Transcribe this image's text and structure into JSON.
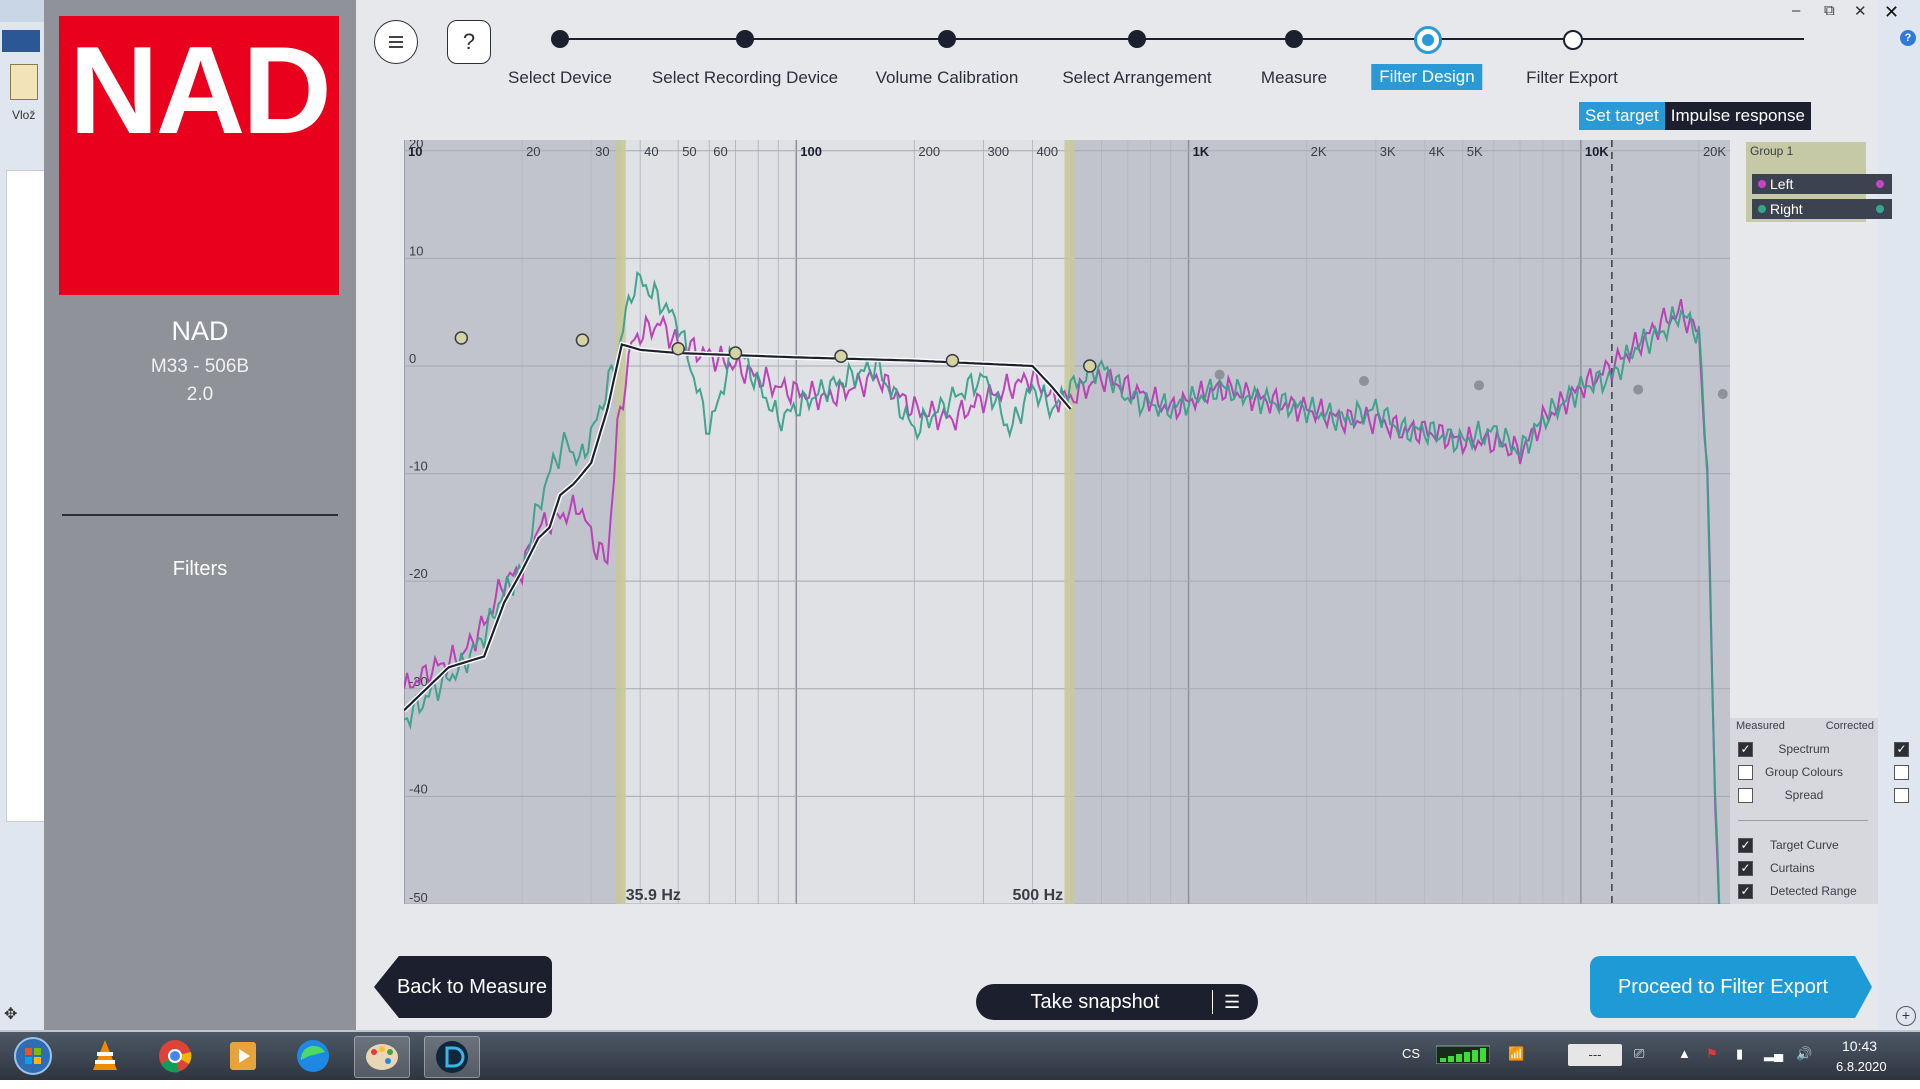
{
  "window": {
    "minimize": "–",
    "restore": "⧉",
    "close": "✕",
    "background_close": "✕",
    "background_paste_label": "Vlož",
    "background_help": "?"
  },
  "sidebar": {
    "logo_text": "NAD",
    "device_name": "NAD",
    "device_model": "M33 - 506B",
    "device_version": "2.0",
    "nav_item": "Filters"
  },
  "toolbar": {
    "menu_icon": "hamburger-icon",
    "help_label": "?"
  },
  "steps": [
    {
      "label": "Select Device",
      "state": "done"
    },
    {
      "label": "Select Recording Device",
      "state": "done"
    },
    {
      "label": "Volume Calibration",
      "state": "done"
    },
    {
      "label": "Select Arrangement",
      "state": "done"
    },
    {
      "label": "Measure",
      "state": "done"
    },
    {
      "label": "Filter Design",
      "state": "active"
    },
    {
      "label": "Filter Export",
      "state": "future"
    }
  ],
  "subtabs": {
    "set_target": "Set target",
    "impulse_response": "Impulse response"
  },
  "chart_data": {
    "type": "line",
    "x_scale": "log",
    "x_ticks": [
      {
        "v": 10,
        "label": "10"
      },
      {
        "v": 20,
        "label": "20"
      },
      {
        "v": 30,
        "label": "30"
      },
      {
        "v": 40,
        "label": "40"
      },
      {
        "v": 50,
        "label": "50"
      },
      {
        "v": 60,
        "label": "60"
      },
      {
        "v": 100,
        "label": "100"
      },
      {
        "v": 200,
        "label": "200"
      },
      {
        "v": 300,
        "label": "300"
      },
      {
        "v": 400,
        "label": "400"
      },
      {
        "v": 1000,
        "label": "1K"
      },
      {
        "v": 2000,
        "label": "2K"
      },
      {
        "v": 3000,
        "label": "3K"
      },
      {
        "v": 4000,
        "label": "4K"
      },
      {
        "v": 5000,
        "label": "5K"
      },
      {
        "v": 10000,
        "label": "10K"
      },
      {
        "v": 20000,
        "label": "20K"
      }
    ],
    "y_ticks": [
      20,
      10,
      0,
      -10,
      -20,
      -30,
      -40,
      -50
    ],
    "xlim": [
      10,
      24000
    ],
    "ylim": [
      -50,
      21
    ],
    "curtain_low_hz": 35.9,
    "curtain_high_hz": 500,
    "curtain_low_label": "35.9 Hz",
    "curtain_high_label": "500 Hz",
    "dashed_marker_hz": 12000,
    "target_curve": {
      "x": [
        10,
        13,
        16,
        18,
        20,
        22,
        23.5,
        25,
        27,
        28.5,
        30,
        33,
        35.9,
        40,
        50,
        100,
        200,
        400,
        450,
        500
      ],
      "y": [
        -32,
        -28,
        -27,
        -22,
        -19,
        -16,
        -15,
        -12,
        -11,
        -10,
        -9,
        -4,
        2,
        1.5,
        1.2,
        0.8,
        0.5,
        0,
        -2,
        -4
      ]
    },
    "target_points": {
      "x": [
        14,
        28.5,
        50,
        70,
        130,
        250,
        560
      ],
      "y": [
        2.6,
        2.4,
        1.6,
        1.2,
        0.9,
        0.5,
        0
      ]
    },
    "inactive_points": {
      "x": [
        14,
        1200,
        2800,
        5500,
        14000,
        23000
      ],
      "y": [
        2.6,
        -0.8,
        -1.4,
        -1.8,
        -2.2,
        -2.6
      ]
    },
    "series": [
      {
        "name": "Left",
        "color": "#b83bb5",
        "x": [
          10,
          12,
          14,
          16,
          18,
          20,
          22,
          25,
          28,
          31,
          33,
          35,
          38,
          40,
          45,
          50,
          60,
          70,
          90,
          120,
          160,
          200,
          250,
          300,
          350,
          400,
          450,
          500,
          600,
          700,
          900,
          1200,
          1500,
          2000,
          2500,
          3000,
          3500,
          4000,
          5000,
          6000,
          7000,
          8000,
          10000,
          12000,
          14000,
          16000,
          18000,
          20000,
          21000,
          22000,
          23000
        ],
        "y": [
          -30,
          -28,
          -27,
          -24,
          -20,
          -19,
          -15,
          -14,
          -13,
          -17,
          -18,
          -6,
          2,
          3,
          4,
          2,
          1,
          0,
          -2,
          -3,
          -1,
          -4,
          -5,
          -3,
          -2,
          -1,
          -3,
          -3,
          -1,
          -2,
          -4,
          -2,
          -3,
          -4,
          -5,
          -5,
          -6,
          -6,
          -7,
          -7,
          -8,
          -5,
          -2,
          0,
          2,
          4,
          5,
          3,
          -10,
          -40,
          -60
        ]
      },
      {
        "name": "Right",
        "color": "#3aa08a",
        "x": [
          10,
          12,
          14,
          16,
          18,
          20,
          22,
          24,
          26,
          28,
          31,
          35,
          38,
          40,
          45,
          50,
          60,
          70,
          90,
          120,
          160,
          200,
          250,
          300,
          350,
          400,
          450,
          500,
          600,
          700,
          900,
          1200,
          1500,
          2000,
          2500,
          3000,
          3500,
          4000,
          5000,
          6000,
          7000,
          8000,
          10000,
          12000,
          14000,
          16000,
          18000,
          20000,
          21000,
          22000,
          23000
        ],
        "y": [
          -33,
          -30,
          -28,
          -25,
          -21,
          -19,
          -13,
          -9,
          -7,
          -9,
          -5,
          1,
          7,
          8,
          6,
          4,
          -6,
          2,
          -5,
          -2,
          0,
          -6,
          -3,
          -1,
          -6,
          -2,
          -4,
          -2,
          0,
          -3,
          -4,
          -2,
          -3,
          -4,
          -5,
          -4,
          -6,
          -6,
          -7,
          -6,
          -8,
          -5,
          -2,
          -1,
          2,
          3,
          5,
          3,
          -10,
          -40,
          -60
        ]
      }
    ]
  },
  "group_panel": {
    "title": "Group 1",
    "channels": [
      {
        "label": "Left",
        "color": "#c844c6"
      },
      {
        "label": "Right",
        "color": "#2fa88e"
      }
    ]
  },
  "legend": {
    "measured_label": "Measured",
    "corrected_label": "Corrected",
    "rows": [
      {
        "label": "Spectrum",
        "measured": true,
        "corrected": true
      },
      {
        "label": "Group Colours",
        "measured": false,
        "corrected": false
      },
      {
        "label": "Spread",
        "measured": false,
        "corrected": false
      }
    ],
    "options": [
      {
        "label": "Target Curve",
        "checked": true
      },
      {
        "label": "Curtains",
        "checked": true
      },
      {
        "label": "Detected Range",
        "checked": true
      }
    ]
  },
  "buttons": {
    "back": "Back to Measure",
    "snapshot": "Take snapshot",
    "proceed": "Proceed to Filter Export"
  },
  "taskbar": {
    "language": "CS",
    "input_placeholder": "---",
    "time": "10:43",
    "date": "6.8.2020"
  },
  "colors": {
    "accent": "#2a9ad6",
    "dark": "#1b1f2e",
    "brand_red": "#e8001c",
    "target": "#1b1f2e",
    "curtain": "#c8c99a"
  }
}
